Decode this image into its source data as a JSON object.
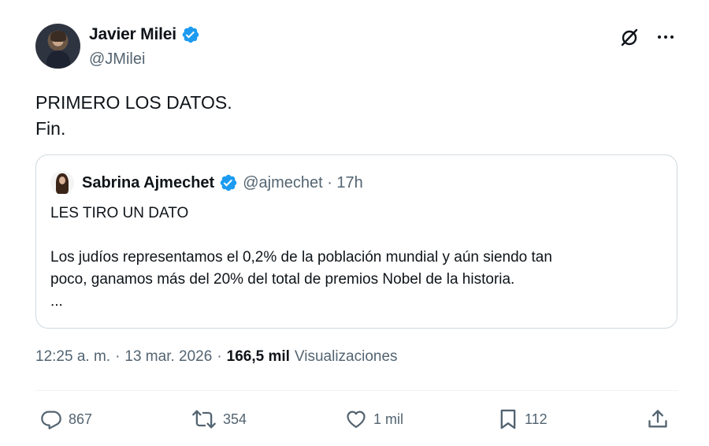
{
  "author": {
    "display_name": "Javier Milei",
    "handle": "@JMilei",
    "verified": true
  },
  "header_icons": [
    "grok-icon",
    "more-icon"
  ],
  "tweet": {
    "line1": "PRIMERO LOS DATOS.",
    "line2": "Fin."
  },
  "quoted_tweet": {
    "display_name": "Sabrina Ajmechet",
    "handle_time": "@ajmechet · 17h",
    "line1": "LES TIRO UN DATO",
    "line2": "Los judíos representamos el 0,2% de la población mundial y aún siendo tan",
    "line3": "poco, ganamos más del 20% del total de premios Nobel de la historia.",
    "ellipsis": "..."
  },
  "meta": {
    "time": "12:25 a. m.",
    "sep1": "·",
    "date": "13 mar. 2026",
    "sep2": "·",
    "views_count": "166,5 mil",
    "views_label": "Visualizaciones"
  },
  "actions": {
    "replies": "867",
    "reposts": "354",
    "likes": "1 mil",
    "bookmarks": "112"
  },
  "colors": {
    "text_primary": "#0f1419",
    "text_secondary": "#536471",
    "verified_blue": "#1d9bf0",
    "border": "#cfd9de"
  }
}
